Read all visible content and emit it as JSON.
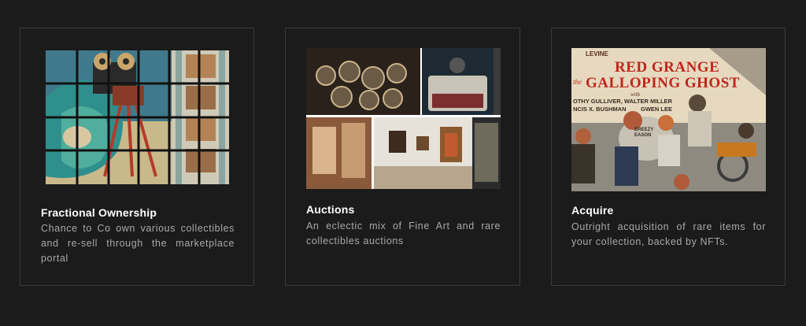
{
  "cards": [
    {
      "title": "Fractional Ownership",
      "description": "Chance to Co own various collectibles and re-sell through the marketplace portal",
      "image": "film-camera-poster-grid-image"
    },
    {
      "title": "Auctions",
      "description": "An eclectic mix of Fine Art and rare collectibles auctions",
      "image": "auction-collage-image"
    },
    {
      "title": "Acquire",
      "description": "Outright acquisition of rare items for your collection, backed by NFTs.",
      "image": "red-grange-poster-image",
      "poster_text": {
        "line1": "RED GRANGE",
        "line2": "GALLOPING GHOST",
        "prefix": "the",
        "top": "LEVINE",
        "credits1": "OTHY GULLIVER, WALTER MILLER",
        "credits2": "NCIS X. BUSHMAN",
        "credits3": "GWEN LEE",
        "with": "with",
        "bottom1": "BREEZY",
        "bottom2": "EASON"
      }
    }
  ]
}
